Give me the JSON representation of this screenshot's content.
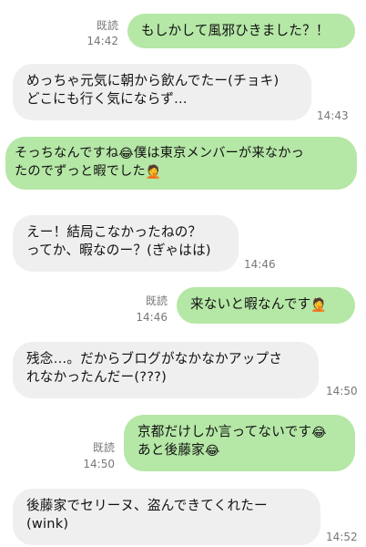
{
  "messages": [
    {
      "dir": "out",
      "lines": [
        "もしかして風邪ひきました？！"
      ],
      "read": "既読",
      "time": "14:42"
    },
    {
      "dir": "in",
      "lines": [
        "めっちゃ元気に朝から飲んでたー(チョキ)",
        "どこにも行く気にならず…"
      ],
      "time": "14:43"
    },
    {
      "dir": "out",
      "lines": [
        "そっちなんですね",
        "僕は東京メンバーが来なかっ",
        "たのでずっと暇でした"
      ],
      "emoji": [
        "😂",
        "🤦"
      ]
    },
    {
      "dir": "in",
      "lines": [
        "えー！結局こなかったねの？",
        "ってか、暇なのー？(ぎゃはは)"
      ],
      "time": "14:46"
    },
    {
      "dir": "out",
      "lines": [
        "来ないと暇なんです"
      ],
      "emoji": [
        "🤦"
      ],
      "read": "既読",
      "time": "14:46"
    },
    {
      "dir": "in",
      "lines": [
        "残念…。だからブログがなかなかアップさ",
        "れなかったんだー(???)"
      ],
      "time": "14:50"
    },
    {
      "dir": "out",
      "lines": [
        "京都だけしか言ってないです",
        "あと後藤家"
      ],
      "emoji": [
        "😂",
        "😂"
      ],
      "read": "既読",
      "time": "14:50"
    },
    {
      "dir": "in",
      "lines": [
        "後藤家でセリーヌ、盗んできてくれたー",
        "(wink)"
      ],
      "time": "14:52"
    }
  ]
}
